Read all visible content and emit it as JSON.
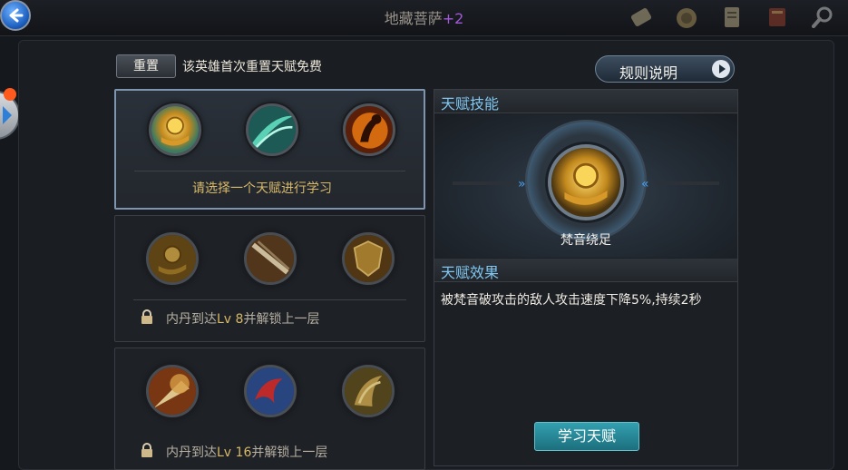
{
  "header": {
    "hero_name": "地藏菩萨",
    "hero_rank": "+2",
    "top_icons": [
      "scroll-icon",
      "coin-bag-icon",
      "map-scroll-icon",
      "book-icon",
      "search-icon"
    ]
  },
  "toolbar": {
    "reset_label": "重置",
    "reset_note": "该英雄首次重置天赋免费",
    "rules_label": "规则说明"
  },
  "tiers": [
    {
      "skills": [
        "golden-hand-orb-icon",
        "jade-wind-blade-icon",
        "fire-fist-icon"
      ],
      "status_text": "请选择一个天赋进行学习",
      "locked": false
    },
    {
      "skills": [
        "golden-hand-orb-icon",
        "cross-blade-icon",
        "golden-shield-icon"
      ],
      "status_prefix": "内丹到达",
      "status_level": "Lv 8",
      "status_suffix": "并解锁上一层",
      "locked": true
    },
    {
      "skills": [
        "light-burst-icon",
        "red-wing-icon",
        "golden-claw-icon"
      ],
      "status_prefix": "内丹到达",
      "status_level": "Lv 16",
      "status_suffix": "并解锁上一层",
      "locked": true
    }
  ],
  "detail": {
    "skill_header": "天赋技能",
    "selected_skill": "梵音绕足",
    "effect_header": "天赋效果",
    "effect_text": "被梵音破攻击的敌人攻击速度下降5%,持续2秒",
    "learn_label": "学习天赋"
  },
  "colors": {
    "header_accent": "#7fc6f0",
    "tier_text": "#d9b968",
    "rank_purple": "#a25ad8",
    "learn_button": "#1c6f7d"
  }
}
